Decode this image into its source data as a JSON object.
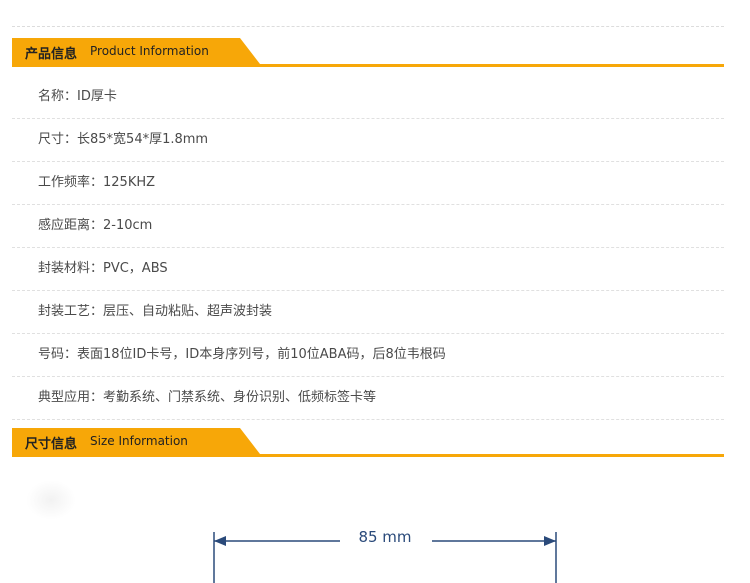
{
  "product_section": {
    "title_cn": "产品信息",
    "title_en": "Product Information"
  },
  "info_rows": [
    "名称：ID厚卡",
    "尺寸：长85*宽54*厚1.8mm",
    "工作频率：125KHZ",
    "感应距离：2-10cm",
    "封装材料：PVC，ABS",
    "封装工艺：层压、自动粘贴、超声波封装",
    "号码：表面18位ID卡号，ID本身序列号，前10位ABA码，后8位韦根码",
    "典型应用：考勤系统、门禁系统、身份识别、低频标签卡等"
  ],
  "size_section": {
    "title_cn": "尺寸信息",
    "title_en": "Size Information"
  },
  "dimension": {
    "width_label": "85 mm",
    "line_color": "#2a4a7a"
  },
  "colors": {
    "accent": "#f7a708"
  }
}
